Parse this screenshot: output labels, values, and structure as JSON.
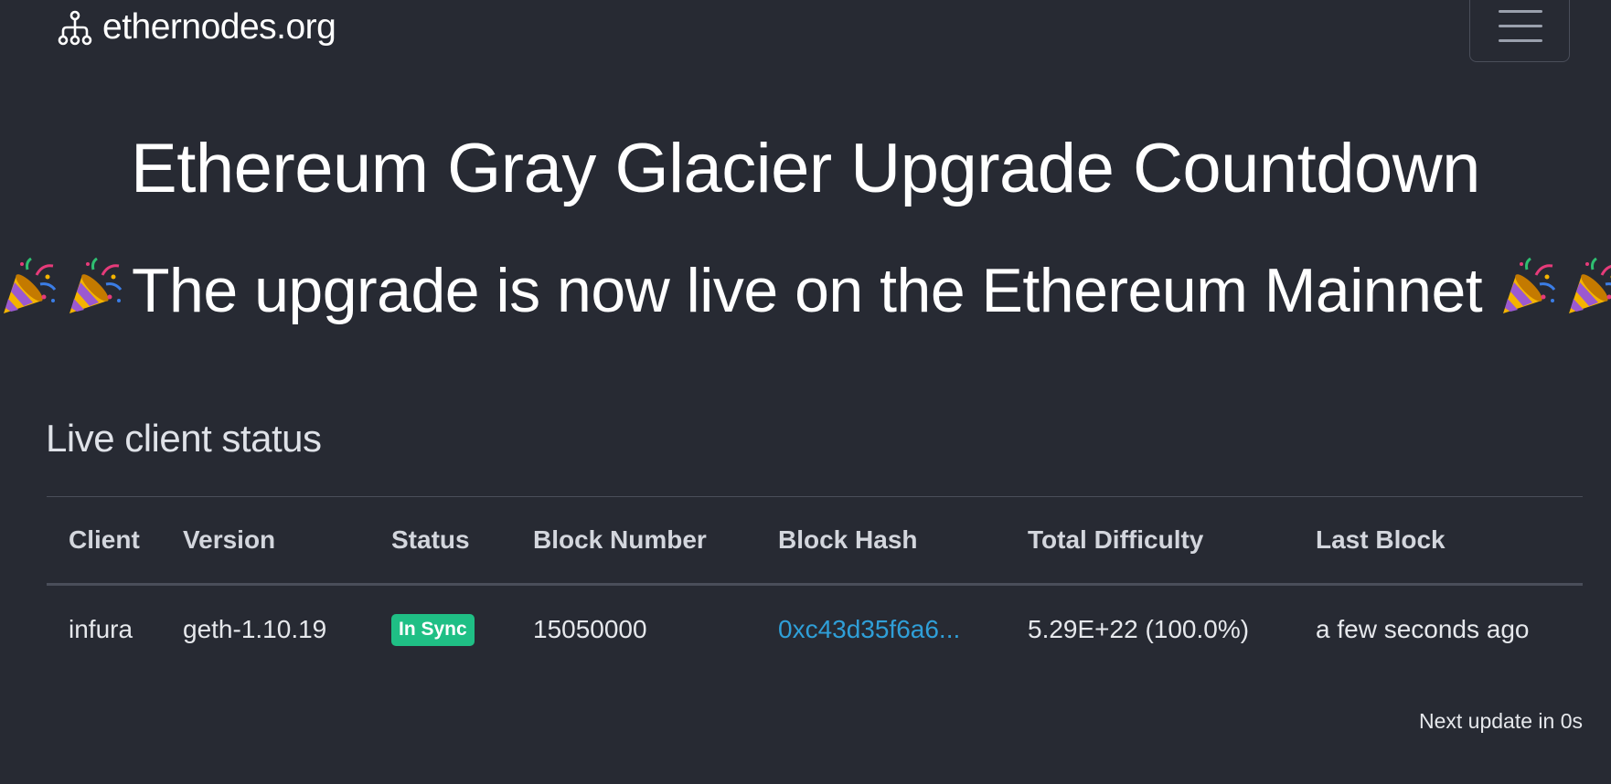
{
  "navbar": {
    "brand": "ethernodes.org",
    "brand_icon": "network-nodes-icon",
    "menu_icon": "hamburger-menu-icon"
  },
  "headline": "Ethereum Gray Glacier Upgrade Countdown",
  "banner": {
    "text": "The upgrade is now live on the Ethereum Mainnet",
    "emoji": "party-popper-icon"
  },
  "section_title": "Live client status",
  "table": {
    "headers": [
      "Client",
      "Version",
      "Status",
      "Block Number",
      "Block Hash",
      "Total Difficulty",
      "Last Block"
    ],
    "rows": [
      {
        "client": "infura",
        "version": "geth-1.10.19",
        "status": "In Sync",
        "block_number": "15050000",
        "block_hash": "0xc43d35f6a6...",
        "total_difficulty": "5.29E+22 (100.0%)",
        "last_block": "a few seconds ago"
      }
    ]
  },
  "next_update": "Next update in 0s",
  "colors": {
    "background": "#272a33",
    "badge_green": "#1fbf85",
    "link_blue": "#2f9fd8"
  }
}
